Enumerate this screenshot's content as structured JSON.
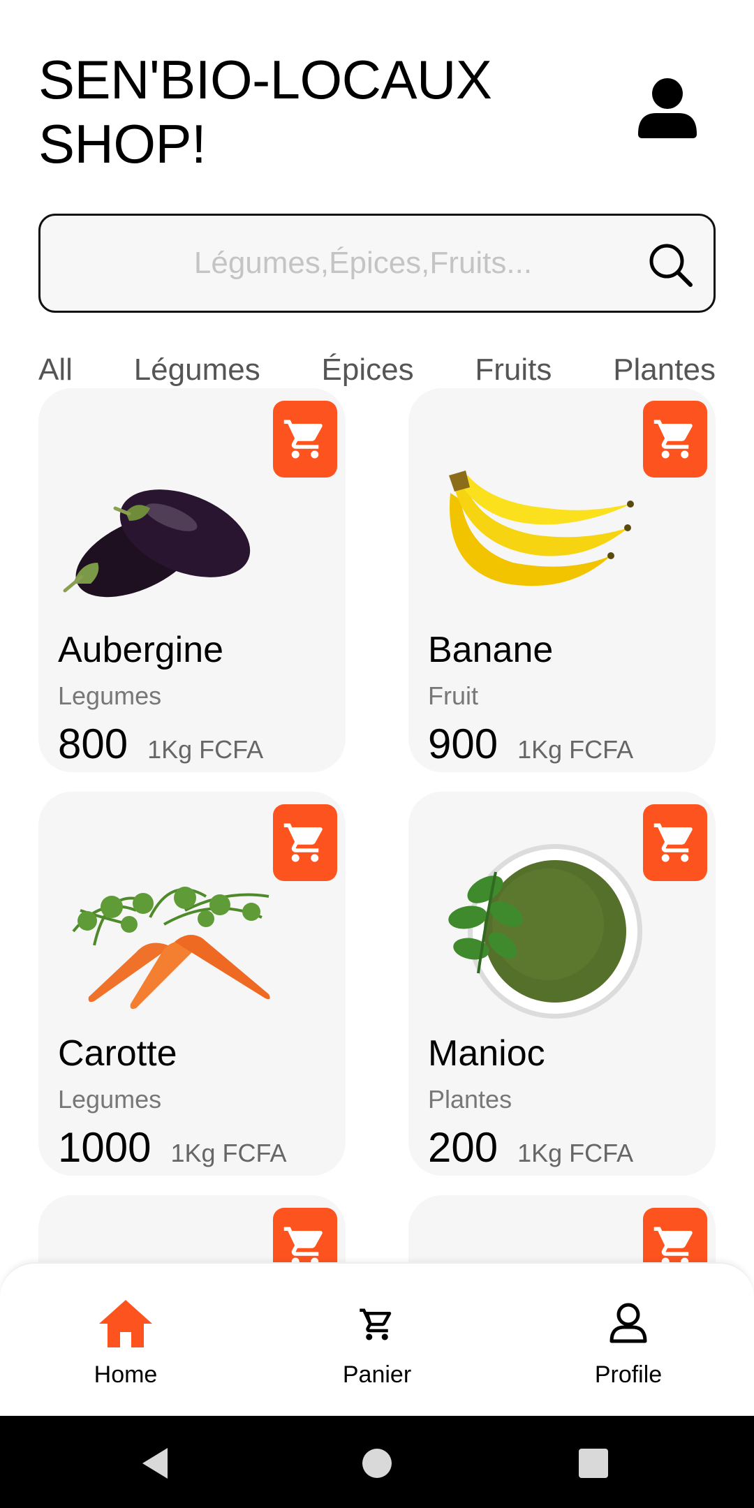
{
  "header": {
    "title_line1": "SEN'BIO-LOCAUX",
    "title_line2": "SHOP!"
  },
  "search": {
    "placeholder": "Légumes,Épices,Fruits...",
    "value": ""
  },
  "tabs": [
    {
      "label": "All"
    },
    {
      "label": "Légumes"
    },
    {
      "label": "Épices"
    },
    {
      "label": "Fruits"
    },
    {
      "label": "Plantes"
    }
  ],
  "products": [
    {
      "name": "Aubergine",
      "category": "Legumes",
      "price": "800",
      "unit": "1Kg FCFA",
      "image": "eggplant"
    },
    {
      "name": "Banane",
      "category": "Fruit",
      "price": "900",
      "unit": "1Kg FCFA",
      "image": "banana"
    },
    {
      "name": "Carotte",
      "category": "Legumes",
      "price": "1000",
      "unit": "1Kg FCFA",
      "image": "carrot"
    },
    {
      "name": "Manioc",
      "category": "Plantes",
      "price": "200",
      "unit": "1Kg FCFA",
      "image": "green-powder-bowl"
    }
  ],
  "bottom_nav": {
    "items": [
      {
        "label": "Home",
        "icon": "home-icon",
        "active": true
      },
      {
        "label": "Panier",
        "icon": "cart-icon",
        "active": false
      },
      {
        "label": "Profile",
        "icon": "user-icon",
        "active": false
      }
    ]
  },
  "colors": {
    "accent": "#fd541f",
    "card_bg": "#f6f6f6",
    "text_primary": "#000000",
    "text_secondary": "#777777"
  }
}
